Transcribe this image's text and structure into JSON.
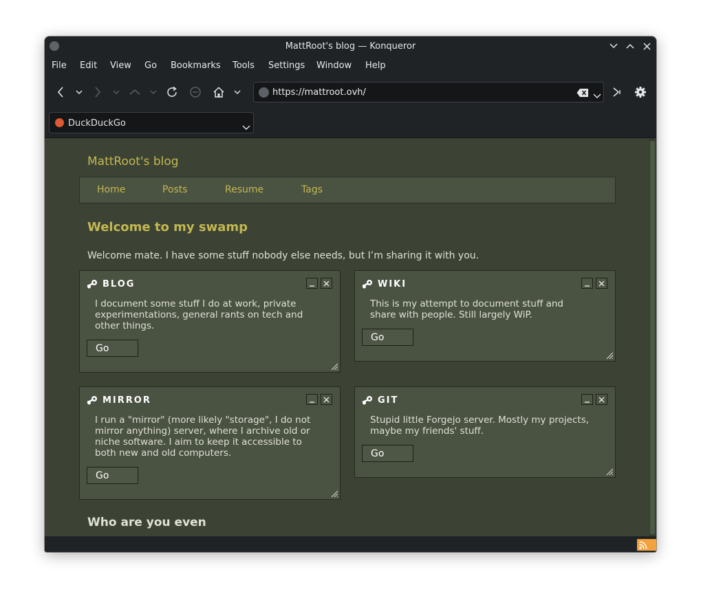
{
  "window": {
    "title": "MattRoot's blog — Konqueror"
  },
  "menubar": {
    "items": [
      "File",
      "Edit",
      "View",
      "Go",
      "Bookmarks",
      "Tools",
      "Settings",
      "Window",
      "Help"
    ]
  },
  "urlbar": {
    "url": "https://mattroot.ovh/"
  },
  "search": {
    "engine": "DuckDuckGo"
  },
  "page": {
    "site_title": "MattRoot's blog",
    "nav": [
      "Home",
      "Posts",
      "Resume",
      "Tags"
    ],
    "welcome_heading": "Welcome to my swamp",
    "intro": "Welcome mate. I have some stuff nobody else needs, but I’m sharing it with you.",
    "cards": [
      {
        "title": "BLOG",
        "desc": [
          "I document some stuff I do at work, private",
          "experimentations, general rants on tech and",
          "other things."
        ],
        "button": "Go"
      },
      {
        "title": "WIKI",
        "desc": [
          "This is my attempt to document stuff and",
          "share with people. Still largely WiP."
        ],
        "button": "Go"
      },
      {
        "title": "MIRROR",
        "desc": [
          "I run a \"mirror\" (more likely \"storage\", I do not",
          "mirror anything) server, where I archive old or",
          "niche software. I aim to keep it accessible to",
          "both new and old computers."
        ],
        "button": "Go"
      },
      {
        "title": "GIT",
        "desc": [
          "Stupid little Forgejo server. Mostly my projects,",
          "maybe my friends' stuff."
        ],
        "button": "Go"
      }
    ],
    "who_heading": "Who are you even"
  },
  "colors": {
    "page_bg": "#3c4334",
    "panel_bg": "#4a5242",
    "link": "#c3b852",
    "text": "#dfe1d5",
    "chrome": "#202326"
  },
  "icons": {
    "back": "arrow-left-icon",
    "forward": "arrow-right-icon",
    "up": "arrow-up-icon",
    "reload": "reload-icon",
    "stop": "stop-icon",
    "home": "home-icon",
    "clear": "clear-icon",
    "go": "go-icon",
    "settings": "gear-icon",
    "card": "steam-icon",
    "rss": "rss-icon"
  }
}
